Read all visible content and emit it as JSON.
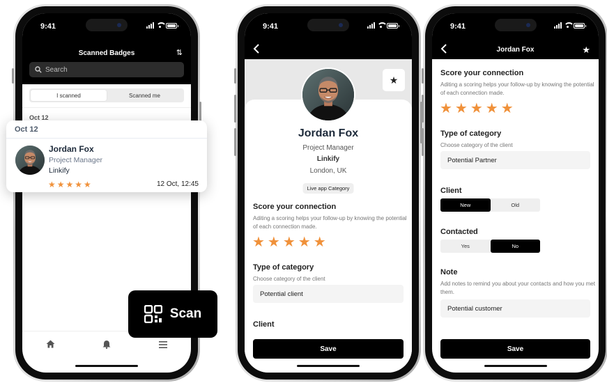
{
  "status_time": "9:41",
  "colors": {
    "accent_star": "#f0913a",
    "primary": "#000000"
  },
  "phone1": {
    "title": "Scanned Badges",
    "search_placeholder": "Search",
    "tabs": [
      "I scanned",
      "Scanned me"
    ],
    "date_group": "Oct 12",
    "nav_icons": [
      "home-icon",
      "bell-icon",
      "menu-icon"
    ]
  },
  "card": {
    "date": "Oct 12",
    "name": "Jordan Fox",
    "role": "Project Manager",
    "company": "Linkify",
    "rating": 5,
    "stars": "★★★★★",
    "time": "12 Oct, 12:45"
  },
  "scan_button": {
    "label": "Scan"
  },
  "phone2": {
    "name": "Jordan Fox",
    "role": "Project Manager",
    "company": "Linkify",
    "location": "London, UK",
    "badge": "Live app Category",
    "score_title": "Score your connection",
    "score_desc": "Aditing a scoring helps your follow-up by knowing the potential of each connection made.",
    "stars": "★★★★★",
    "category_title": "Type of category",
    "category_desc": "Choose category of the client",
    "category_value": "Potential client",
    "client_title": "Client",
    "save_label": "Save"
  },
  "phone3": {
    "title": "Jordan Fox",
    "score_title": "Score your connection",
    "score_desc": "Aditing a scoring helps your follow-up by knowing the potential of each connection made.",
    "stars": "★★★★★",
    "category_title": "Type of category",
    "category_desc": "Choose category of the client",
    "category_value": "Potential Partner",
    "client_title": "Client",
    "client_options": [
      "New",
      "Old"
    ],
    "contacted_title": "Contacted",
    "contacted_options": [
      "Yes",
      "No"
    ],
    "note_title": "Note",
    "note_desc": "Add notes to remind you about your contacts and how you met them.",
    "note_value": "Potential customer",
    "save_label": "Save"
  }
}
